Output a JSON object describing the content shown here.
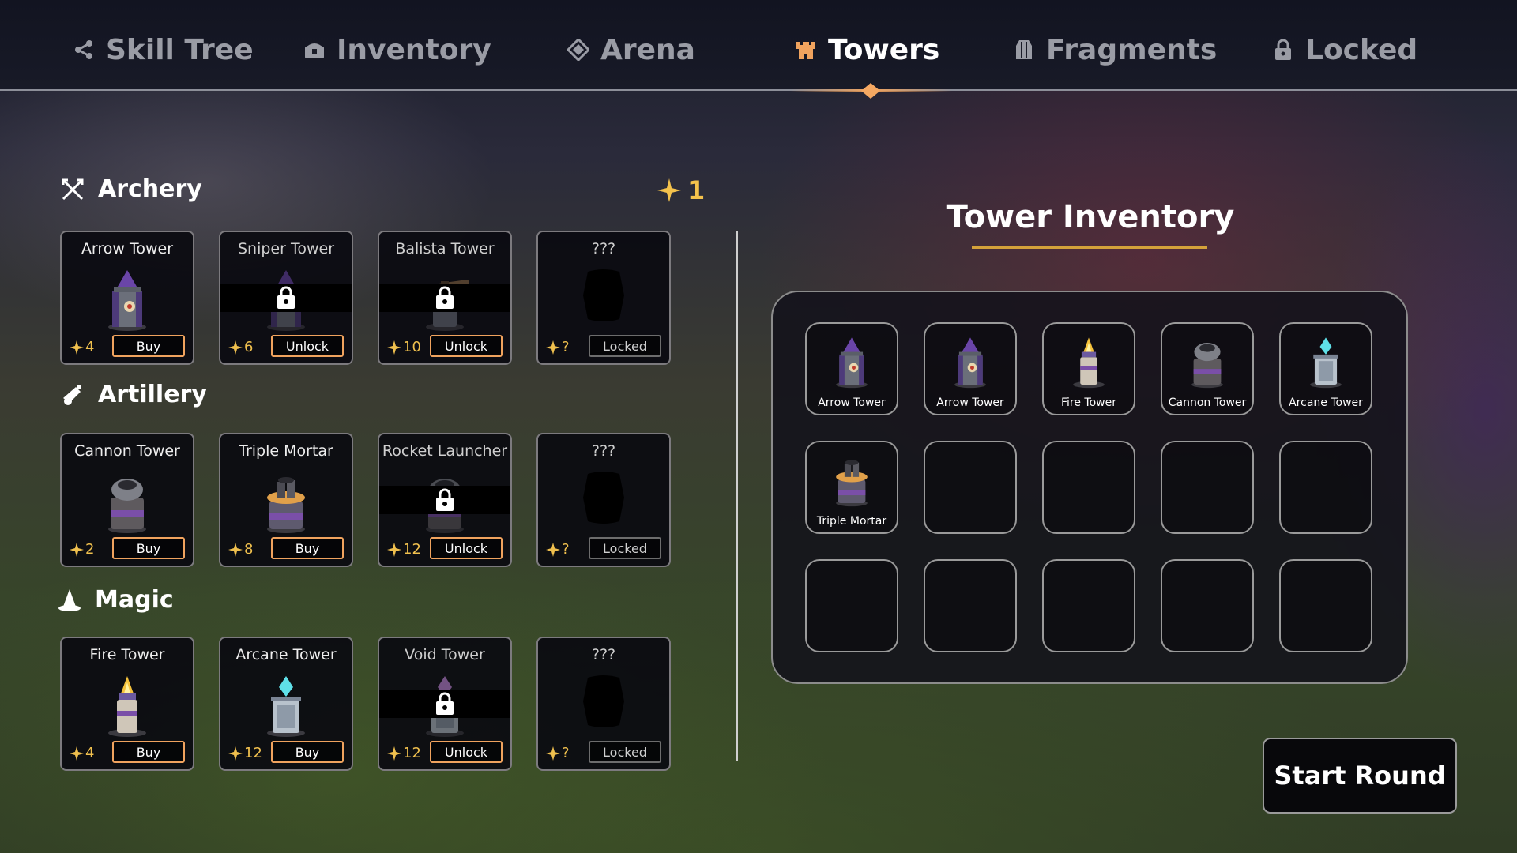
{
  "tabs": [
    {
      "label": "Skill Tree",
      "icon": "share-icon",
      "active": false
    },
    {
      "label": "Inventory",
      "icon": "chest-icon",
      "active": false
    },
    {
      "label": "Arena",
      "icon": "diamond-icon",
      "active": false
    },
    {
      "label": "Towers",
      "icon": "castle-icon",
      "active": true
    },
    {
      "label": "Fragments",
      "icon": "crystal-icon",
      "active": false
    },
    {
      "label": "Locked",
      "icon": "lock-icon",
      "active": false
    }
  ],
  "skill_points": "1",
  "sections": [
    {
      "title": "Archery",
      "icon": "crossed-arrows-icon",
      "cards": [
        {
          "name": "Arrow Tower",
          "cost": "4",
          "action": "Buy",
          "state": "available"
        },
        {
          "name": "Sniper Tower",
          "cost": "6",
          "action": "Unlock",
          "state": "locked"
        },
        {
          "name": "Balista Tower",
          "cost": "10",
          "action": "Unlock",
          "state": "locked"
        },
        {
          "name": "???",
          "cost": "?",
          "action": "Locked",
          "state": "unknown"
        }
      ]
    },
    {
      "title": "Artillery",
      "icon": "cannon-icon",
      "cards": [
        {
          "name": "Cannon Tower",
          "cost": "2",
          "action": "Buy",
          "state": "available"
        },
        {
          "name": "Triple Mortar",
          "cost": "8",
          "action": "Buy",
          "state": "available"
        },
        {
          "name": "Rocket Launcher",
          "cost": "12",
          "action": "Unlock",
          "state": "locked"
        },
        {
          "name": "???",
          "cost": "?",
          "action": "Locked",
          "state": "unknown"
        }
      ]
    },
    {
      "title": "Magic",
      "icon": "wizard-hat-icon",
      "cards": [
        {
          "name": "Fire Tower",
          "cost": "4",
          "action": "Buy",
          "state": "available"
        },
        {
          "name": "Arcane Tower",
          "cost": "12",
          "action": "Buy",
          "state": "available"
        },
        {
          "name": "Void Tower",
          "cost": "12",
          "action": "Unlock",
          "state": "locked"
        },
        {
          "name": "???",
          "cost": "?",
          "action": "Locked",
          "state": "unknown"
        }
      ]
    }
  ],
  "inventory": {
    "title": "Tower Inventory",
    "slots": [
      "Arrow Tower",
      "Arrow Tower",
      "Fire Tower",
      "Cannon Tower",
      "Arcane Tower",
      "Triple Mortar",
      "",
      "",
      "",
      "",
      "",
      "",
      "",
      "",
      ""
    ]
  },
  "start_button": "Start Round",
  "colors": {
    "accent_orange": "#f0a35e",
    "star_gold": "#f4c24c",
    "active_tab": "#ffffff",
    "inactive_tab": "#9a9ca5"
  }
}
